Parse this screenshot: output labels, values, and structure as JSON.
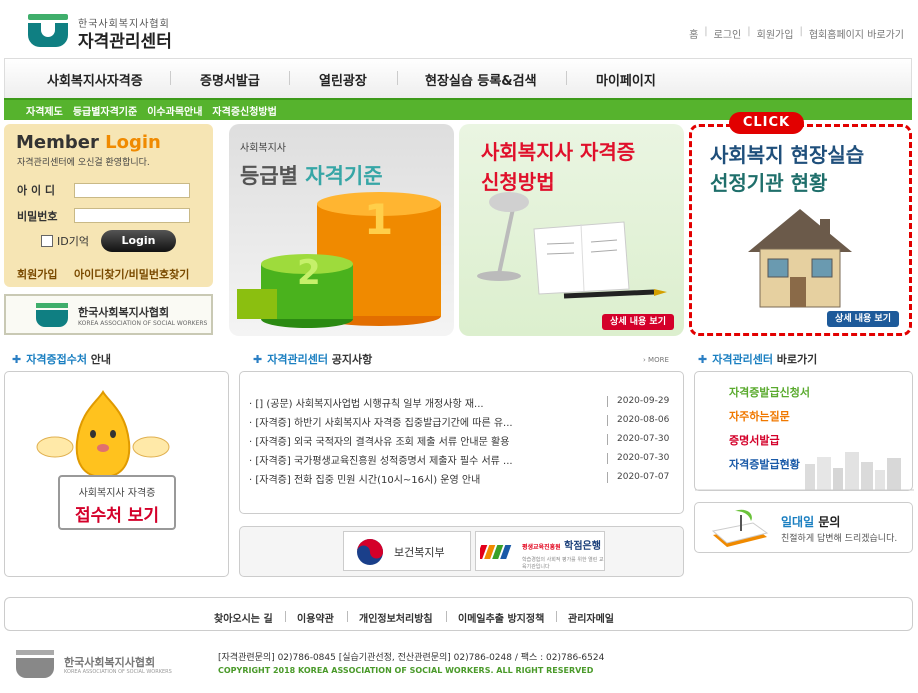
{
  "header": {
    "logo_small": "한국사회복지사협회",
    "logo_big": "자격관리센터",
    "links": [
      "홈",
      "로그인",
      "회원가입",
      "협회홈페이지 바로가기"
    ]
  },
  "gnb": [
    "사회복지사자격증",
    "증명서발급",
    "열린광장",
    "현장실습 등록&검색",
    "마이페이지"
  ],
  "subnav": [
    "자격제도",
    "등급별자격기준",
    "이수과목안내",
    "자격증신청방법"
  ],
  "login": {
    "title_a": "Member",
    "title_b": "Login",
    "welcome": "자격관리센터에 오신걸 환영합니다.",
    "id_label": "아 이 디",
    "pw_label": "비밀번호",
    "remember": "ID기억",
    "button": "Login",
    "join": "회원가입",
    "find": "아이디찾기/비밀번호찾기"
  },
  "assoc": {
    "name": "한국사회복지사협회",
    "eng": "KOREA ASSOCIATION OF SOCIAL WORKERS"
  },
  "banners": {
    "b1_small": "사회복지사",
    "b1_a": "등급별",
    "b1_b": "자격기준",
    "b2_line1": "사회복지사 자격증",
    "b2_line2": "신청방법",
    "b2_detail": "상세 내용 보기",
    "b3_line1": "사회복지 현장실습",
    "b3_line2": "선정기관 현황",
    "b3_detail": "상세 내용 보기",
    "click": "CLICK"
  },
  "sections": {
    "reception_b": "자격증접수처",
    "reception_rest": "안내",
    "notice_b": "자격관리센터",
    "notice_rest": "공지사항",
    "more": "› MORE",
    "quick_b": "자격관리센터",
    "quick_rest": "바로가기"
  },
  "reception": {
    "line1": "사회복지사 자격증",
    "line2": "접수처 보기"
  },
  "notices": [
    {
      "title": "· [] (공문) 사회복지사업법 시행규칙 일부 개정사항 재...",
      "date": "2020-09-29"
    },
    {
      "title": "· [자격증] 하반기 사회복지사 자격증 집중발급기간에 따른 유...",
      "date": "2020-08-06"
    },
    {
      "title": "· [자격증] 외국 국적자의 결격사유 조회 제출 서류 안내문 활용",
      "date": "2020-07-30"
    },
    {
      "title": "· [자격증] 국가평생교육진흥원 성적증명서 제출자 필수 서류 ...",
      "date": "2020-07-30"
    },
    {
      "title": "· [자격증] 전화 집중 민원 시간(10시~16시) 운영 안내",
      "date": "2020-07-07"
    }
  ],
  "partners": {
    "mohw": "보건복지부",
    "bank_name": "학점은행",
    "bank_org": "평생교육진흥원",
    "bank_sub": "학습경험의 사회적 평가를 위한 열린 교육기관입니다"
  },
  "quick": [
    {
      "label": "자격증발급신청서",
      "color": "#5aaa2e"
    },
    {
      "label": "자주하는질문",
      "color": "#f07800"
    },
    {
      "label": "증명서발급",
      "color": "#d4002a"
    },
    {
      "label": "자격증발급현황",
      "color": "#1a5aa8"
    }
  ],
  "onetoone": {
    "title_b": "일대일",
    "title_rest": "문의",
    "sub": "친절하게 답변해 드리겠습니다."
  },
  "footer": {
    "nav": [
      "찾아오시는 길",
      "이용약관",
      "개인정보처리방침",
      "이메일추출 방지정책",
      "관리자메일"
    ],
    "name": "한국사회복지사협회",
    "eng": "KOREA ASSOCIATION OF SOCIAL WORKERS",
    "info": "[자격관련문의] 02)786-0845   [실습기관선정, 전산관련문의] 02)786-0248    /  팩스 : 02)786-6524",
    "copyright": "COPYRIGHT 2018 KOREA ASSOCIATION OF SOCIAL WORKERS. ALL RIGHT RESERVED"
  }
}
